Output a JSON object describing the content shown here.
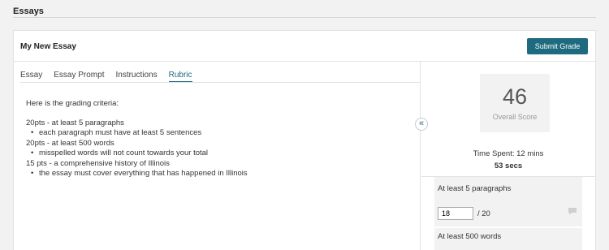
{
  "page": {
    "title": "Essays"
  },
  "essay": {
    "title": "My New Essay"
  },
  "actions": {
    "submit_label": "Submit Grade"
  },
  "tabs": [
    {
      "label": "Essay",
      "active": false
    },
    {
      "label": "Essay Prompt",
      "active": false
    },
    {
      "label": "Instructions",
      "active": false
    },
    {
      "label": "Rubric",
      "active": true
    }
  ],
  "rubric": {
    "intro": "Here is the grading criteria:",
    "criteria": [
      {
        "heading": "20pts - at least 5 paragraphs",
        "note": "each paragraph must have at least 5 sentences"
      },
      {
        "heading": "20pts - at least 500 words",
        "note": "misspelled words will not count towards your total"
      },
      {
        "heading": "15 pts - a comprehensive history of Illinois",
        "note": "the essay must cover everything that has happened in Illinois"
      }
    ]
  },
  "collapse_icon": "double-chevron-left",
  "score": {
    "value": "46",
    "label": "Overall Score"
  },
  "time_spent": {
    "line1": "Time Spent: 12 mins",
    "line2": "53 secs"
  },
  "grading": [
    {
      "title": "At least 5 paragraphs",
      "points": "18",
      "max": "/ 20",
      "comment_icon": "comment-bubble"
    },
    {
      "title": "At least 500 words"
    }
  ],
  "colors": {
    "accent": "#1e6b7f",
    "background": "#f2f2f2"
  }
}
